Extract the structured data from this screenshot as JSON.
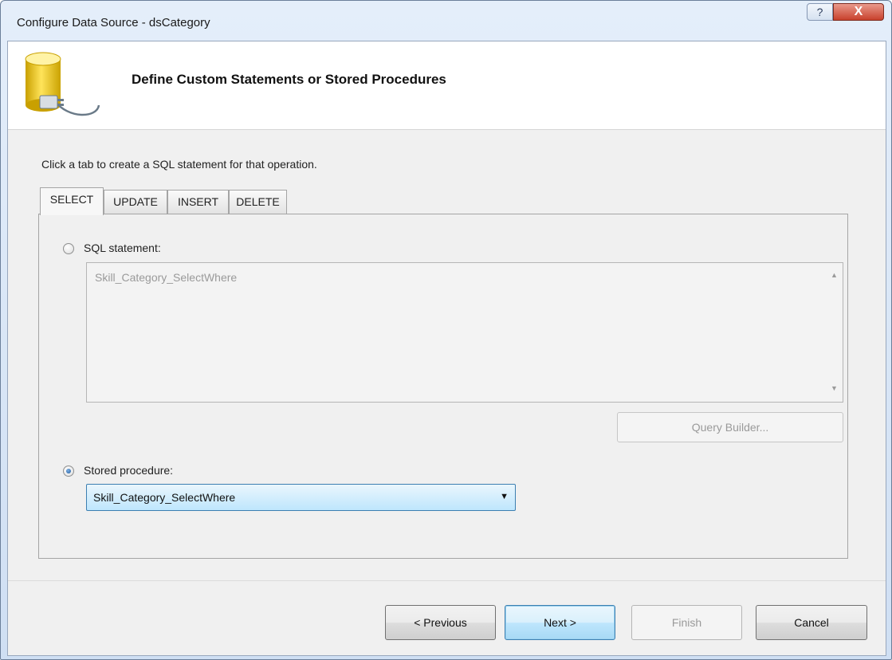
{
  "window": {
    "title": "Configure Data Source - dsCategory",
    "help_label": "?",
    "close_label": "X"
  },
  "header": {
    "title": "Define Custom Statements or Stored Procedures",
    "icon": "database-connector-icon"
  },
  "instruction": "Click a tab to create a SQL statement for that operation.",
  "tabs": [
    {
      "label": "SELECT",
      "active": true
    },
    {
      "label": "UPDATE",
      "active": false
    },
    {
      "label": "INSERT",
      "active": false
    },
    {
      "label": "DELETE",
      "active": false
    }
  ],
  "sql_statement": {
    "label": "SQL statement:",
    "selected": false,
    "value": "Skill_Category_SelectWhere",
    "enabled": false
  },
  "query_builder_label": "Query Builder...",
  "stored_procedure": {
    "label": "Stored procedure:",
    "selected": true,
    "value": "Skill_Category_SelectWhere"
  },
  "buttons": {
    "previous": "< Previous",
    "next": "Next >",
    "finish": "Finish",
    "cancel": "Cancel"
  },
  "colors": {
    "accent": "#3c7fb1",
    "close_button": "#c8412c",
    "disabled_text": "#9a9a9a"
  }
}
